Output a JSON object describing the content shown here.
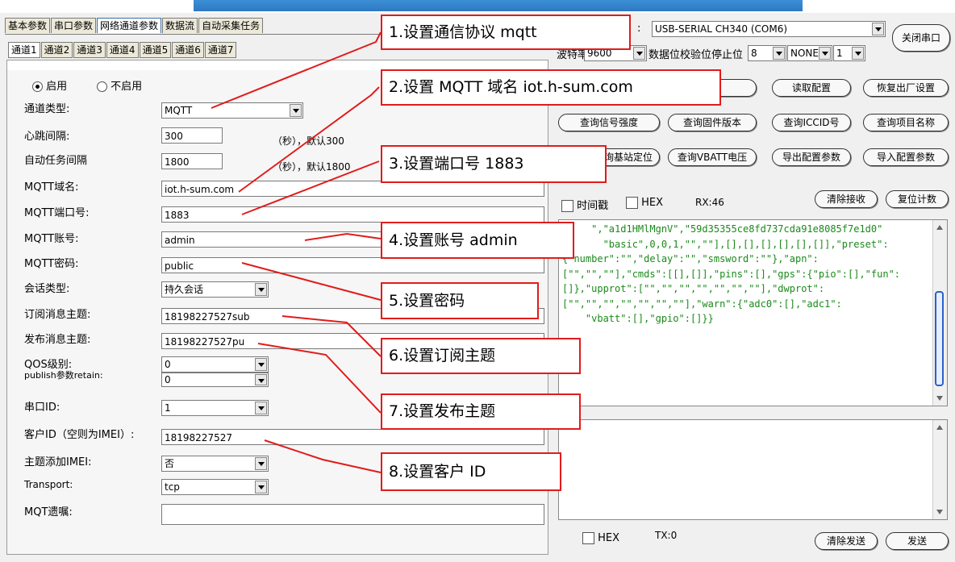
{
  "top_tabs": [
    "基本参数",
    "串口参数",
    "网络通道参数",
    "数据流",
    "自动采集任务"
  ],
  "channel_tabs": [
    "通道1",
    "通道2",
    "通道3",
    "通道4",
    "通道5",
    "通道6",
    "通道7"
  ],
  "enable": {
    "on_label": "启用",
    "off_label": "不启用",
    "selected": "启用"
  },
  "form": {
    "channel_type": {
      "label": "通道类型:",
      "value": "MQTT"
    },
    "heartbeat": {
      "label": "心跳间隔:",
      "value": "300",
      "hint": "（秒），默认300"
    },
    "auto_task": {
      "label": "自动任务间隔",
      "value": "1800",
      "hint": "（秒），默认1800"
    },
    "domain": {
      "label": "MQTT域名:",
      "value": "iot.h-sum.com"
    },
    "port": {
      "label": "MQTT端口号:",
      "value": "1883"
    },
    "account": {
      "label": "MQTT账号:",
      "value": "admin"
    },
    "password": {
      "label": "MQTT密码:",
      "value": "public"
    },
    "session": {
      "label": "会话类型:",
      "value": "持久会话"
    },
    "sub_topic": {
      "label": "订阅消息主题:",
      "value": "18198227527sub"
    },
    "pub_topic": {
      "label": "发布消息主题:",
      "value": "18198227527pu"
    },
    "qos": {
      "label": "QOS级别:",
      "value": "0"
    },
    "retain": {
      "label": "publish参数retain:",
      "value": "0"
    },
    "serial_id": {
      "label": "串口ID:",
      "value": "1"
    },
    "client_id": {
      "label": "客户ID（空则为IMEI）:",
      "value": "18198227527"
    },
    "topic_imei": {
      "label": "主题添加IMEI:",
      "value": "否"
    },
    "transport": {
      "label": "Transport:",
      "value": "tcp"
    },
    "will": {
      "label": "MQT遗嘱:",
      "value": ""
    }
  },
  "serial": {
    "port_prefix": ":",
    "port_value": "USB-SERIAL CH340 (COM6)",
    "close_button": "关闭串口",
    "baud_label": "波特率",
    "baud_value": "9600",
    "databits_label": "数据位校验位停止位",
    "databits_value": "8",
    "parity_value": "NONE",
    "stopbits_value": "1"
  },
  "buttons": {
    "read_config": "读取配置",
    "factory_reset": "恢复出厂设置",
    "query_signal": "查询信号强度",
    "query_fw": "查询固件版本",
    "query_iccid": "查询ICCID号",
    "query_project": "查询项目名称",
    "locate": "查询基站定位",
    "query_vbatt": "查询VBATT电压",
    "export_config": "导出配置参数",
    "import_config": "导入配置参数",
    "clear_rx": "清除接收",
    "reset_count": "复位计数",
    "clear_tx": "清除发送",
    "send": "发送"
  },
  "rx": {
    "timestamp_label": "时间戳",
    "hex_label": "HEX",
    "count": "RX:46",
    "text": "     \",\"a1d1HMlMgnV\",\"59d35355ce8fd737cda91e8085f7e1d0\"\n       \"basic\",0,0,1,\"\",\"\"],[],[],[],[],[],[]],\"preset\":\n{\"number\":\"\",\"delay\":\"\",\"smsword\":\"\"},\"apn\":\n[\"\",\"\",\"\"],\"cmds\":[[],[]],\"pins\":[],\"gps\":{\"pio\":[],\"fun\":\n[]},\"upprot\":[\"\",\"\",\"\",\"\",\"\",\"\",\"\"],\"dwprot\":\n[\"\",\"\",\"\",\"\",\"\",\"\",\"\"],\"warn\":{\"adc0\":[],\"adc1\":\n    \"vbatt\":[],\"gpio\":[]}}"
  },
  "tx": {
    "hex_label": "HEX",
    "count": "TX:0"
  },
  "callouts": [
    "1.设置通信协议 mqtt",
    "2.设置 MQTT 域名 iot.h-sum.com",
    "3.设置端口号 1883",
    "4.设置账号 admin",
    "5.设置密码",
    "6.设置订阅主题",
    "7.设置发布主题",
    "8.设置客户 ID"
  ],
  "colors": {
    "callout_border": "#e21b1b",
    "rx_text": "#1a8a1a",
    "title_band": "#2f78c2"
  }
}
